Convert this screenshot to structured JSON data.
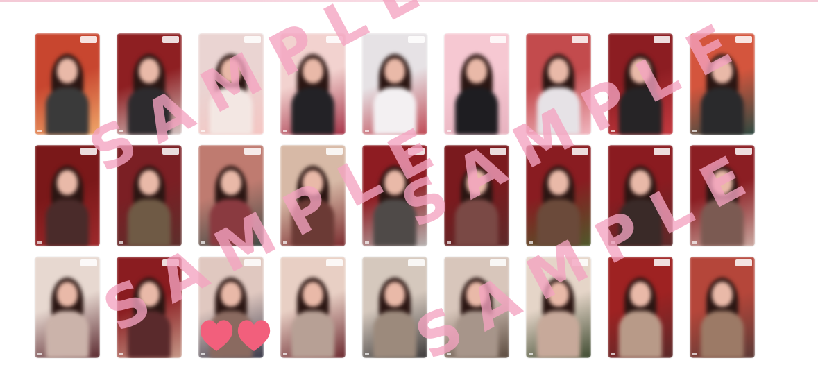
{
  "watermark": {
    "text": "SAMPLE",
    "color": "#f4a3c0"
  },
  "heart_color": "#f25f7c",
  "palettes": [
    [
      "#c8462f",
      "#f0a86a",
      "#3a3a3a"
    ],
    [
      "#8e1f22",
      "#d6c7c5",
      "#2d2b2e"
    ],
    [
      "#ead4d2",
      "#f5c6c3",
      "#f3e7e3"
    ],
    [
      "#f2d2cf",
      "#a7364a",
      "#232226"
    ],
    [
      "#e6e2e5",
      "#bf4a55",
      "#f3f0f2"
    ],
    [
      "#f6c8d2",
      "#e7b2bf",
      "#1e1d21"
    ],
    [
      "#c34b4d",
      "#f1b7c0",
      "#e6e2e6"
    ],
    [
      "#8c1d22",
      "#c53a40",
      "#262426"
    ],
    [
      "#d4553d",
      "#2e4a42",
      "#2a2a2c"
    ],
    [
      "#7a1819",
      "#9e2a2c",
      "#4a2b2a"
    ],
    [
      "#7b1f24",
      "#5d2f2c",
      "#6f5a45"
    ],
    [
      "#bf7b70",
      "#3f4a45",
      "#8a3a40"
    ],
    [
      "#d7b9a6",
      "#7b2d30",
      "#6b3a35"
    ],
    [
      "#8e1c22",
      "#b7b3b1",
      "#4f4a48"
    ],
    [
      "#7a1a1e",
      "#5e2a2a",
      "#7a4945"
    ],
    [
      "#891c21",
      "#4f5a2c",
      "#6b4a3a"
    ],
    [
      "#8a1b20",
      "#5b2a2a",
      "#3a2a28"
    ],
    [
      "#8b1e23",
      "#caa8a0",
      "#7b5a52"
    ],
    [
      "#e7d8d0",
      "#5b2a30",
      "#cbb3aa"
    ],
    [
      "#8a1c20",
      "#c79a8a",
      "#5a2a2c"
    ],
    [
      "#e0c8c0",
      "#3a3a4a",
      "#8a6a60"
    ],
    [
      "#e8cfc4",
      "#6b2a30",
      "#b7a095"
    ],
    [
      "#d5c8bd",
      "#3c3a3a",
      "#9c8a7c"
    ],
    [
      "#d8c6bb",
      "#5a4a3e",
      "#a7958a"
    ],
    [
      "#e5d5c8",
      "#3e4a30",
      "#c7a99a"
    ],
    [
      "#9e2222",
      "#5a2a2a",
      "#b89a88"
    ],
    [
      "#b5463a",
      "#5b3a36",
      "#9c7a66"
    ]
  ]
}
